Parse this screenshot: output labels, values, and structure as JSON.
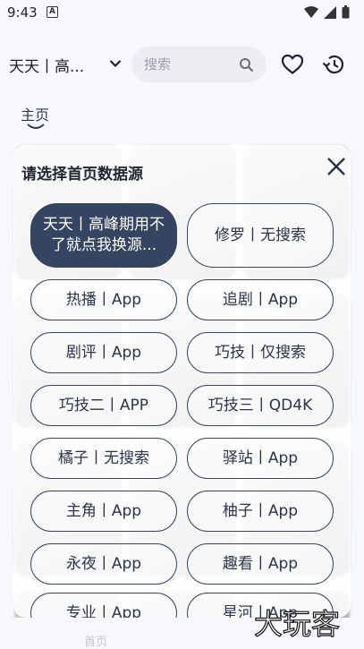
{
  "status_bar": {
    "time": "9:43",
    "notification_glyph": "A"
  },
  "header": {
    "source_label": "天天丨高...",
    "search_placeholder": "搜索",
    "search_value": ""
  },
  "tabs": [
    {
      "label": "主页",
      "active": true
    }
  ],
  "modal": {
    "title": "请选择首页数据源",
    "options": [
      {
        "label": "天天丨高峰期用不了就点我换源...",
        "selected": true
      },
      {
        "label": "修罗丨无搜索",
        "selected": false
      },
      {
        "label": "热播丨App",
        "selected": false
      },
      {
        "label": "追剧丨App",
        "selected": false
      },
      {
        "label": "剧评丨App",
        "selected": false
      },
      {
        "label": "巧技丨仅搜索",
        "selected": false
      },
      {
        "label": "巧技二丨APP",
        "selected": false
      },
      {
        "label": "巧技三丨QD4K",
        "selected": false
      },
      {
        "label": "橘子丨无搜索",
        "selected": false
      },
      {
        "label": "驿站丨App",
        "selected": false
      },
      {
        "label": "主角丨App",
        "selected": false
      },
      {
        "label": "柚子丨App",
        "selected": false
      },
      {
        "label": "永夜丨App",
        "selected": false
      },
      {
        "label": "趣看丨App",
        "selected": false
      },
      {
        "label": "专业丨App",
        "selected": false
      },
      {
        "label": "星河丨App",
        "selected": false
      }
    ]
  },
  "bottom_nav": {
    "home_label": "首页"
  },
  "watermark": {
    "text": "大玩客"
  },
  "colors": {
    "accent": "#354460",
    "background": "#f7f8fb",
    "search_bg": "#eceef3"
  }
}
